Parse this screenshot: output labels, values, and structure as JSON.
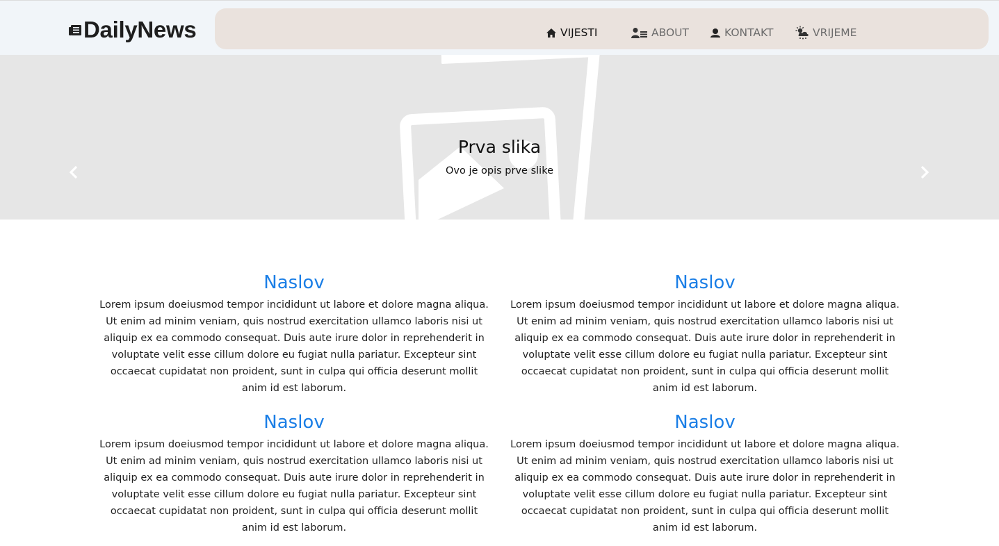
{
  "brand": {
    "name": "DailyNews",
    "icon": "newspaper-icon"
  },
  "nav": [
    {
      "label": "VIJESTI",
      "icon": "home-icon",
      "active": true
    },
    {
      "label": "ABOUT",
      "icon": "users-list-icon",
      "active": false
    },
    {
      "label": "KONTAKT",
      "icon": "user-icon",
      "active": false
    },
    {
      "label": "VRIJEME",
      "icon": "weather-icon",
      "active": false
    }
  ],
  "carousel": {
    "title": "Prva slika",
    "description": "Ovo je opis prve slike",
    "image_icon": "image-placeholder-icon",
    "prev_icon": "chevron-left-icon",
    "next_icon": "chevron-right-icon"
  },
  "articles": [
    {
      "title": "Naslov",
      "body": "Lorem ipsum doeiusmod tempor incididunt ut labore et dolore magna aliqua. Ut enim ad minim veniam, quis nostrud exercitation ullamco laboris nisi ut aliquip ex ea commodo consequat. Duis aute irure dolor in reprehenderit in voluptate velit esse cillum dolore eu fugiat nulla pariatur. Excepteur sint occaecat cupidatat non proident, sunt in culpa qui officia deserunt mollit anim id est laborum."
    },
    {
      "title": "Naslov",
      "body": "Lorem ipsum doeiusmod tempor incididunt ut labore et dolore magna aliqua. Ut enim ad minim veniam, quis nostrud exercitation ullamco laboris nisi ut aliquip ex ea commodo consequat. Duis aute irure dolor in reprehenderit in voluptate velit esse cillum dolore eu fugiat nulla pariatur. Excepteur sint occaecat cupidatat non proident, sunt in culpa qui officia deserunt mollit anim id est laborum."
    },
    {
      "title": "Naslov",
      "body": "Lorem ipsum doeiusmod tempor incididunt ut labore et dolore magna aliqua. Ut enim ad minim veniam, quis nostrud exercitation ullamco laboris nisi ut aliquip ex ea commodo consequat. Duis aute irure dolor in reprehenderit in voluptate velit esse cillum dolore eu fugiat nulla pariatur. Excepteur sint occaecat cupidatat non proident, sunt in culpa qui officia deserunt mollit anim id est laborum."
    },
    {
      "title": "Naslov",
      "body": "Lorem ipsum doeiusmod tempor incididunt ut labore et dolore magna aliqua. Ut enim ad minim veniam, quis nostrud exercitation ullamco laboris nisi ut aliquip ex ea commodo consequat. Duis aute irure dolor in reprehenderit in voluptate velit esse cillum dolore eu fugiat nulla pariatur. Excepteur sint occaecat cupidatat non proident, sunt in culpa qui officia deserunt mollit anim id est laborum."
    }
  ],
  "colors": {
    "accent": "#1a7ee6",
    "topbar_bg": "#f1f5f9",
    "nav_bg": "#eae2dd",
    "hero_bg": "#e6e6e6"
  }
}
